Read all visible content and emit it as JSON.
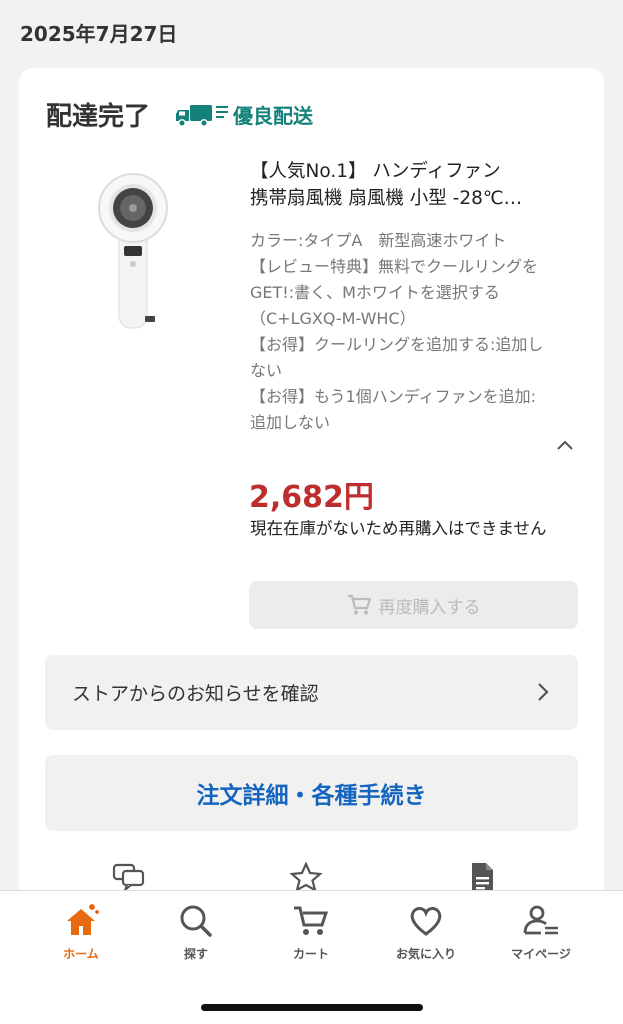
{
  "order_date": "2025年7月27日",
  "order": {
    "status": "配達完了",
    "shipping_badge": "優良配送",
    "product_title_line1": "【人気No.1】 ハンディファン",
    "product_title_line2": "携帯扇風機 扇風機 小型 -28℃…",
    "options": [
      "カラー:タイプA　新型高速ホワイト",
      "【レビュー特典】無料でクールリングをGET!:書く、Mホワイトを選択する（C+LGXQ-M-WHC）",
      "【お得】クールリングを追加する:追加しない",
      "【お得】もう1個ハンディファンを追加:追加しない"
    ],
    "price": "2,682円",
    "stock_note": "現在在庫がないため再購入はできません",
    "rebuy_label": "再度購入する",
    "store_notice_label": "ストアからのお知らせを確認",
    "order_details_label": "注文詳細・各種手続き"
  },
  "action_icons": [
    "chat-icon",
    "star-outline-icon",
    "document-icon"
  ],
  "tabbar": {
    "tabs": [
      {
        "label": "ホーム",
        "icon": "home-icon",
        "active": true
      },
      {
        "label": "探す",
        "icon": "search-icon",
        "active": false
      },
      {
        "label": "カート",
        "icon": "cart-icon",
        "active": false
      },
      {
        "label": "お気に入り",
        "icon": "heart-icon",
        "active": false
      },
      {
        "label": "マイページ",
        "icon": "mypage-icon",
        "active": false
      }
    ]
  },
  "colors": {
    "accent_orange": "#e86a10",
    "price_red": "#bf2e2e",
    "link_blue": "#1565c0",
    "badge_teal": "#14827a"
  }
}
